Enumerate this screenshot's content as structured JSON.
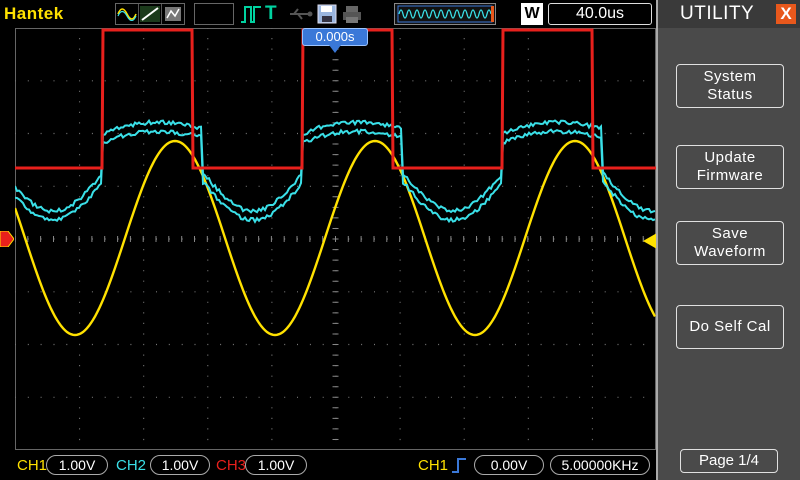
{
  "topbar": {
    "brand": "Hantek",
    "acquire_mode": "W",
    "time_base": "40.0us"
  },
  "screen": {
    "trigger_position": "0.000s"
  },
  "channels": [
    {
      "label": "CH1",
      "scale": "1.00V",
      "color": "#ffe100"
    },
    {
      "label": "CH2",
      "scale": "1.00V",
      "color": "#3ae0e8"
    },
    {
      "label": "CH3",
      "scale": "1.00V",
      "color": "#e8201c"
    }
  ],
  "trigger": {
    "source": "CH1",
    "level": "0.00V",
    "frequency": "5.00000KHz"
  },
  "menu": {
    "title": "UTILITY",
    "buttons": [
      {
        "label": "System\nStatus"
      },
      {
        "label": "Update\nFirmware"
      },
      {
        "label": "Save\nWaveform"
      },
      {
        "label": "Do Self Cal"
      }
    ],
    "page": "Page 1/4"
  },
  "colors": {
    "ch1": "#ffe100",
    "ch2": "#3ae0e8",
    "ch3": "#e8201c",
    "accent": "#3a78d8",
    "close": "#e8581c"
  }
}
